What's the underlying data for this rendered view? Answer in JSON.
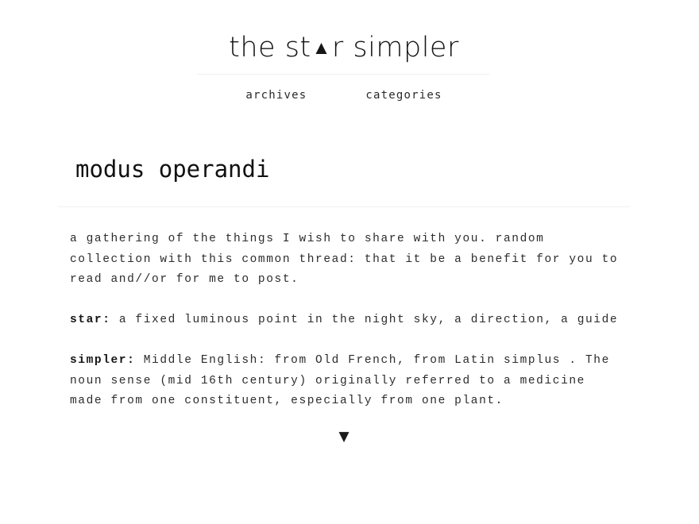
{
  "site": {
    "title_before": "the st",
    "title_glyph": "▲",
    "title_after": "r simpler"
  },
  "nav": {
    "items": [
      {
        "label": "archives"
      },
      {
        "label": "categories"
      }
    ]
  },
  "page": {
    "title": "modus operandi",
    "intro_lines": [
      "a gathering of the things I wish to share with you. random",
      "collection with this common thread: that it be a benefit for you to",
      "read and//or for me to post."
    ],
    "definitions": [
      {
        "term": "star:",
        "lines": [
          " a fixed luminous point in the night sky, a direction, a guide"
        ]
      },
      {
        "term": "simpler:",
        "lines": [
          " Middle English: from Old French, from Latin simplus . The",
          "noun sense (mid 16th century) originally referred to a medicine",
          "made from one constituent, especially from one plant."
        ]
      }
    ],
    "more_glyph": "▼"
  }
}
